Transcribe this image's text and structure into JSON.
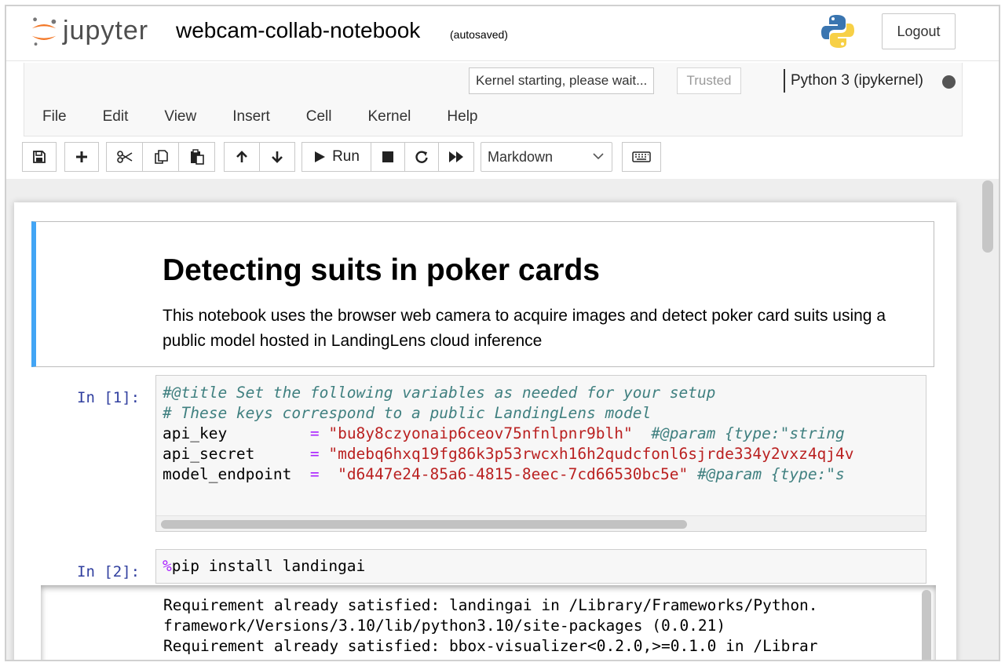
{
  "header": {
    "logo_text": "jupyter",
    "notebook_title": "webcam-collab-notebook",
    "save_status": "(autosaved)",
    "logout_label": "Logout"
  },
  "status": {
    "kernel_message": "Kernel starting, please wait...",
    "trusted_label": "Trusted",
    "kernel_name": "Python 3 (ipykernel)"
  },
  "menu": [
    "File",
    "Edit",
    "View",
    "Insert",
    "Cell",
    "Kernel",
    "Help"
  ],
  "toolbar": {
    "run_label": "Run",
    "cell_type": "Markdown",
    "icons": [
      "save-icon",
      "plus-icon",
      "cut-icon",
      "copy-icon",
      "paste-icon",
      "arrow-up-icon",
      "arrow-down-icon",
      "play-icon",
      "stop-icon",
      "restart-icon",
      "fast-forward-icon",
      "chevron-down-icon",
      "keyboard-icon"
    ]
  },
  "cells": {
    "markdown": {
      "title": "Detecting suits in poker cards",
      "text": "This notebook uses the browser web camera to acquire images and detect poker card suits using a public model hosted in LandingLens cloud inference"
    },
    "code1": {
      "prompt": "In [1]:",
      "comment1": "#@title Set the following variables as needed for your setup",
      "comment2": "# These keys correspond to a public LandingLens model",
      "line3_var": "api_key         ",
      "line3_op": "=",
      "line3_str": " \"bu8y8czyonaip6ceov75nfnlpnr9blh\"",
      "line3_cm": "  #@param {type:\"string",
      "line4_var": "api_secret      ",
      "line4_op": "=",
      "line4_str": " \"mdebq6hxq19fg86k3p53rwcxh16h2qudcfonl6sjrde334y2vxz4qj4v",
      "line5_var": "model_endpoint  ",
      "line5_op": "=",
      "line5_str": "  \"d6447e24-85a6-4815-8eec-7cd66530bc5e\"",
      "line5_cm": " #@param {type:\"s"
    },
    "code2": {
      "prompt": "In [2]:",
      "magic": "%",
      "code": "pip install landingai"
    },
    "output2": {
      "lines": [
        "Requirement already satisfied: landingai in /Library/Frameworks/Python.",
        "framework/Versions/3.10/lib/python3.10/site-packages (0.0.21)",
        "Requirement already satisfied: bbox-visualizer<0.2.0,>=0.1.0 in /Librar"
      ]
    }
  },
  "colors": {
    "prompt": "#303f9f",
    "comment": "#408080",
    "string": "#ba2121",
    "operator": "#aa22ff",
    "md_border": "#42a5f5"
  }
}
